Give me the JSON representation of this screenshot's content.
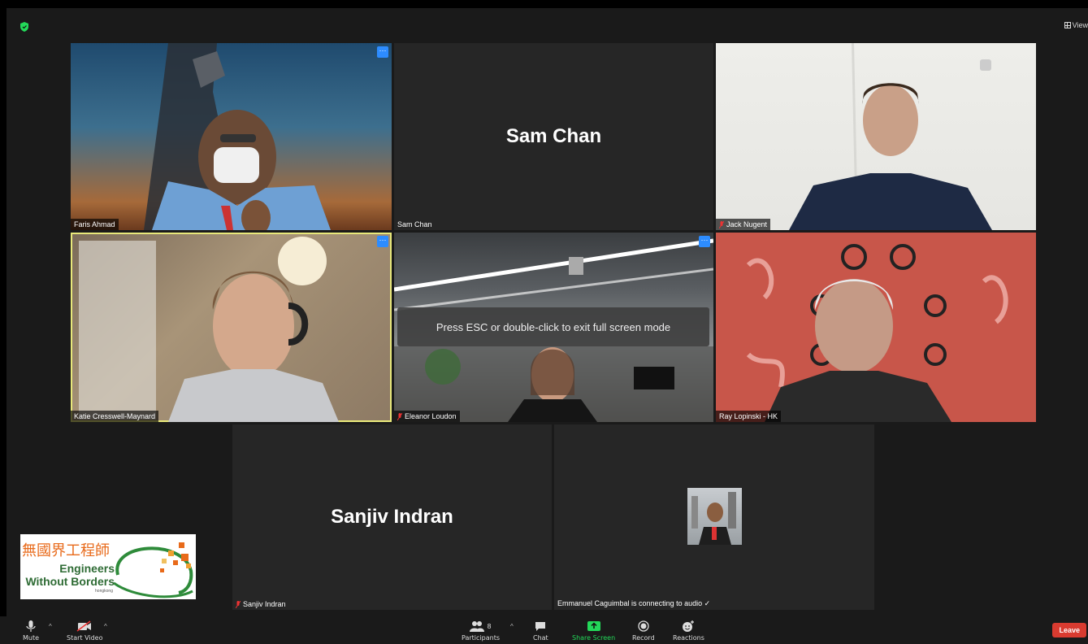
{
  "view_button": "View",
  "toast": "Press ESC or double-click to exit full screen mode",
  "tiles": [
    {
      "name": "Faris Ahmad",
      "muted": false
    },
    {
      "name": "Sam Chan",
      "big_name": "Sam Chan",
      "muted": false
    },
    {
      "name": "Jack Nugent",
      "muted": true
    },
    {
      "name": "Katie Cresswell-Maynard",
      "muted": false
    },
    {
      "name": "Eleanor Loudon",
      "muted": true
    },
    {
      "name": "Ray Lopinski - HK",
      "muted": false
    },
    {
      "name": "Sanjiv Indran",
      "big_name": "Sanjiv Indran",
      "muted": true
    },
    {
      "name": "Emmanuel Caguimbal is connecting to audio ✓"
    }
  ],
  "logo": {
    "chinese": "無國界工程師",
    "line1": "Engineers",
    "line2": "Without Borders",
    "line3": "hongkong"
  },
  "toolbar": {
    "mute": "Mute",
    "start_video": "Start Video",
    "participants": "Participants",
    "participant_count": "8",
    "chat": "Chat",
    "share_screen": "Share Screen",
    "record": "Record",
    "reactions": "Reactions",
    "leave": "Leave"
  },
  "colors": {
    "share_green": "#23d959",
    "leave_red": "#d93b30",
    "accent_blue": "#2d8cff",
    "active_speaker": "#e8e87a",
    "ewb_orange": "#e86a1a",
    "ewb_green": "#2e8b3a"
  }
}
